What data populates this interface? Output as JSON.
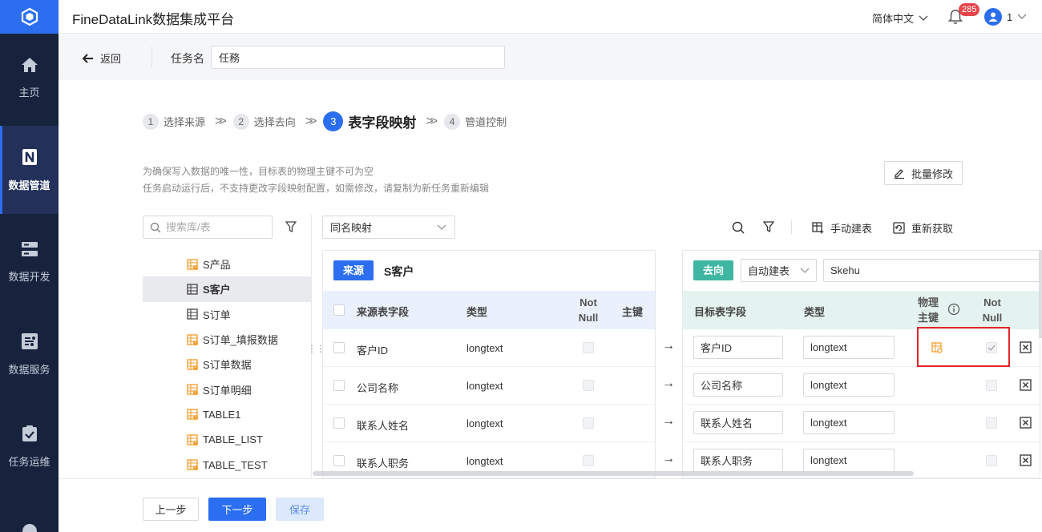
{
  "app": {
    "title": "FineDataLink数据集成平台"
  },
  "header": {
    "language": "简体中文",
    "notification_count": "285",
    "user": "1"
  },
  "sidebar": {
    "items": [
      {
        "label": "主页",
        "icon": "home-icon"
      },
      {
        "label": "数据管道",
        "icon": "pipeline-icon",
        "active": true
      },
      {
        "label": "数据开发",
        "icon": "develop-icon"
      },
      {
        "label": "数据服务",
        "icon": "service-icon"
      },
      {
        "label": "任务运维",
        "icon": "ops-icon"
      }
    ]
  },
  "task": {
    "back_label": "返回",
    "name_label": "任务名",
    "name_value": "任務"
  },
  "steps": [
    {
      "num": "1",
      "label": "选择来源"
    },
    {
      "num": "2",
      "label": "选择去向"
    },
    {
      "num": "3",
      "label": "表字段映射",
      "current": true
    },
    {
      "num": "4",
      "label": "管道控制"
    }
  ],
  "hints": [
    "为确保写入数据的唯一性，目标表的物理主键不可为空",
    "任务启动运行后，不支持更改字段映射配置，如需修改，请复制为新任务重新编辑"
  ],
  "batch_edit_label": "批量修改",
  "search": {
    "placeholder": "搜索库/表"
  },
  "tables": [
    {
      "name": "S产品",
      "icon": "table-warning-icon"
    },
    {
      "name": "S客户",
      "icon": "table-icon",
      "selected": true
    },
    {
      "name": "S订单",
      "icon": "table-icon"
    },
    {
      "name": "S订单_填报数据",
      "icon": "table-warning-icon"
    },
    {
      "name": "S订单数据",
      "icon": "table-warning-icon"
    },
    {
      "name": "S订单明细",
      "icon": "table-warning-icon"
    },
    {
      "name": "TABLE1",
      "icon": "table-warning-icon"
    },
    {
      "name": "TABLE_LIST",
      "icon": "table-warning-icon"
    },
    {
      "name": "TABLE_TEST",
      "icon": "table-warning-icon"
    }
  ],
  "mapping": {
    "mode": "同名映射"
  },
  "toolbar": {
    "manual_create": "手动建表",
    "refetch": "重新获取"
  },
  "source": {
    "tag": "来源",
    "table": "S客户",
    "headers": {
      "field": "来源表字段",
      "type": "类型",
      "notnull": [
        "Not",
        "Null"
      ],
      "pk": "主键"
    },
    "rows": [
      {
        "field": "客户ID",
        "type": "longtext"
      },
      {
        "field": "公司名称",
        "type": "longtext"
      },
      {
        "field": "联系人姓名",
        "type": "longtext"
      },
      {
        "field": "联系人职务",
        "type": "longtext"
      }
    ]
  },
  "target": {
    "tag": "去向",
    "create_mode": "自动建表",
    "table": "Skehu",
    "headers": {
      "field": "目标表字段",
      "type": "类型",
      "pk": [
        "物理",
        "主键"
      ],
      "notnull": [
        "Not",
        "Null"
      ]
    },
    "rows": [
      {
        "field": "客户ID",
        "type": "longtext",
        "pk": true,
        "notnull": true
      },
      {
        "field": "公司名称",
        "type": "longtext",
        "pk": false,
        "notnull": false
      },
      {
        "field": "联系人姓名",
        "type": "longtext",
        "pk": false,
        "notnull": false
      },
      {
        "field": "联系人职务",
        "type": "longtext",
        "pk": false,
        "notnull": false
      }
    ]
  },
  "footer": {
    "prev": "上一步",
    "next": "下一步",
    "save": "保存"
  },
  "colors": {
    "accent": "#2b6ff0",
    "sidebar": "#17233d",
    "target_tag": "#3fb6a1",
    "target_header": "#e4f3ef",
    "source_header": "#eaf1fd",
    "highlight": "#e5252a",
    "warning": "#f39b29"
  }
}
